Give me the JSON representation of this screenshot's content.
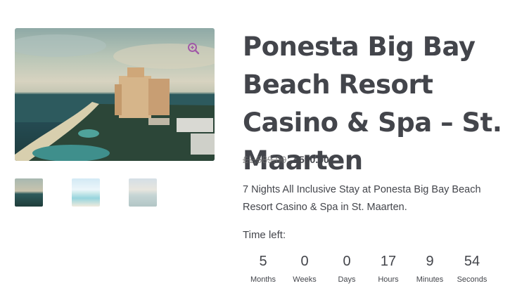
{
  "product": {
    "title": "Ponesta Big Bay Beach Resort Casino & Spa – St. Maarten",
    "price_original": "£1,589.00",
    "price_sale": "£590.00",
    "description": "7 Nights All Inclusive Stay at Ponesta Big Bay Beach Resort Casino & Spa in St. Maarten."
  },
  "gallery": {
    "zoom_icon": "zoom-in-icon",
    "thumbnails_count": 3
  },
  "countdown": {
    "label": "Time left:",
    "units": [
      {
        "value": "5",
        "label": "Months"
      },
      {
        "value": "0",
        "label": "Weeks"
      },
      {
        "value": "0",
        "label": "Days"
      },
      {
        "value": "17",
        "label": "Hours"
      },
      {
        "value": "9",
        "label": "Minutes"
      },
      {
        "value": "54",
        "label": "Seconds"
      }
    ]
  },
  "colors": {
    "text": "#43454b",
    "accent_zoom": "#a15aa8"
  }
}
